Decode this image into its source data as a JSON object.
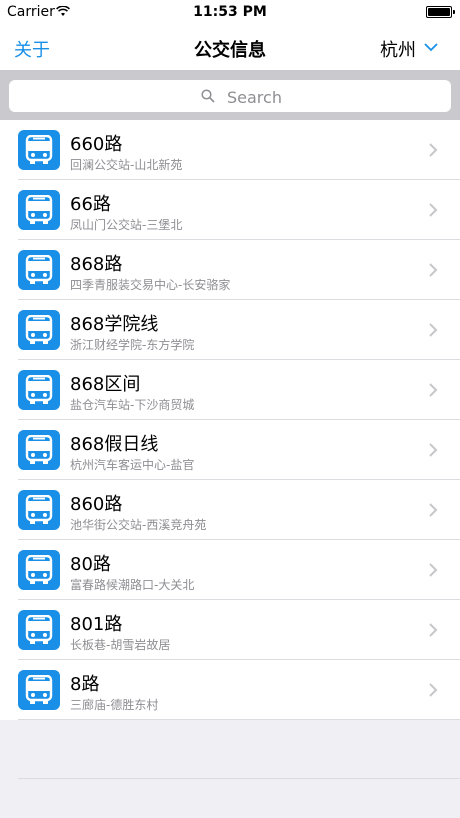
{
  "status_bar": {
    "carrier": "Carrier",
    "time": "11:53 PM"
  },
  "nav": {
    "left_label": "关于",
    "title": "公交信息",
    "city": "杭州"
  },
  "search": {
    "placeholder": "Search"
  },
  "routes": [
    {
      "name": "660路",
      "stops": "回澜公交站-山北新苑"
    },
    {
      "name": "66路",
      "stops": "凤山门公交站-三堡北"
    },
    {
      "name": "868路",
      "stops": "四季青服装交易中心-长安骆家"
    },
    {
      "name": "868学院线",
      "stops": "浙江财经学院-东方学院"
    },
    {
      "name": "868区间",
      "stops": "盐仓汽车站-下沙商贸城"
    },
    {
      "name": "868假日线",
      "stops": "杭州汽车客运中心-盐官"
    },
    {
      "name": "860路",
      "stops": "池华街公交站-西溪竞舟苑"
    },
    {
      "name": "80路",
      "stops": "富春路候潮路口-大关北"
    },
    {
      "name": "801路",
      "stops": "长板巷-胡雪岩故居"
    },
    {
      "name": "8路",
      "stops": "三廊庙-德胜东村"
    }
  ],
  "colors": {
    "accent": "#1a8fe8"
  }
}
